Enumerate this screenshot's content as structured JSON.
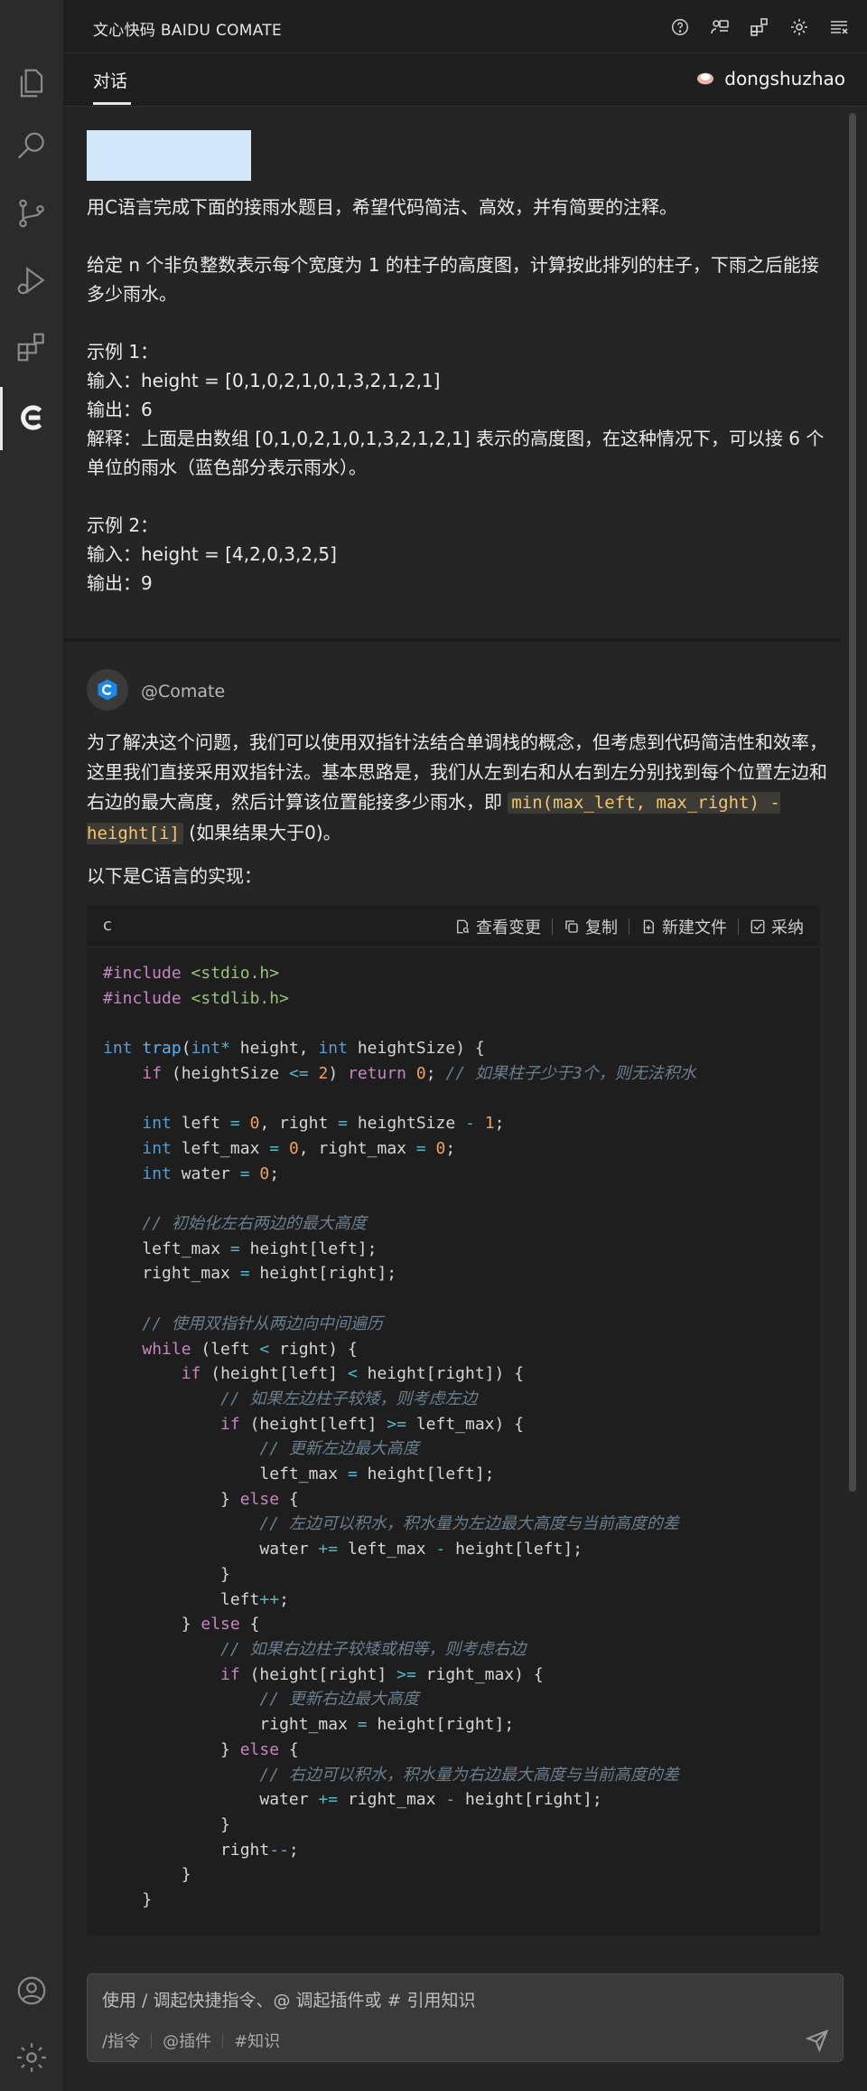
{
  "app": {
    "title": "文心快码 BAIDU COMATE",
    "tab": "对话",
    "user": "dongshuzhao"
  },
  "activity_bar": [
    "files-icon",
    "search-icon",
    "source-control-icon",
    "run-debug-icon",
    "extensions-icon",
    "comate-icon",
    "account-icon",
    "settings-gear-icon"
  ],
  "title_actions": [
    "help-icon",
    "feedback-icon",
    "plugins-icon",
    "settings-icon",
    "menu-list-icon"
  ],
  "user_message": {
    "text": "用C语言完成下面的接雨水题目，希望代码简洁、高效，并有简要的注释。\n\n给定 n 个非负整数表示每个宽度为 1 的柱子的高度图，计算按此排列的柱子，下雨之后能接多少雨水。\n\n示例 1：\n输入：height = [0,1,0,2,1,0,1,3,2,1,2,1]\n输出：6\n解释：上面是由数组 [0,1,0,2,1,0,1,3,2,1,2,1] 表示的高度图，在这种情况下，可以接 6 个单位的雨水（蓝色部分表示雨水）。\n\n示例 2：\n输入：height = [4,2,0,3,2,5]\n输出：9"
  },
  "bot": {
    "name": "@Comate",
    "para1_a": "为了解决这个问题，我们可以使用双指针法结合单调栈的概念，但考虑到代码简洁性和效率，这里我们直接采用双指针法。基本思路是，我们从左到右和从右到左分别找到每个位置左边和右边的最大高度，然后计算该位置能接多少雨水，即 ",
    "para1_code": "min(max_left, max_right) - height[i]",
    "para1_b": " (如果结果大于0)。",
    "para2": "以下是C语言的实现：",
    "code_lang": "c",
    "code_actions": [
      "查看变更",
      "复制",
      "新建文件",
      "采纳"
    ]
  },
  "input": {
    "placeholder": "使用 / 调起快捷指令、@ 调起插件或 # 引用知识",
    "tools": [
      "/指令",
      "@插件",
      "#知识"
    ]
  }
}
